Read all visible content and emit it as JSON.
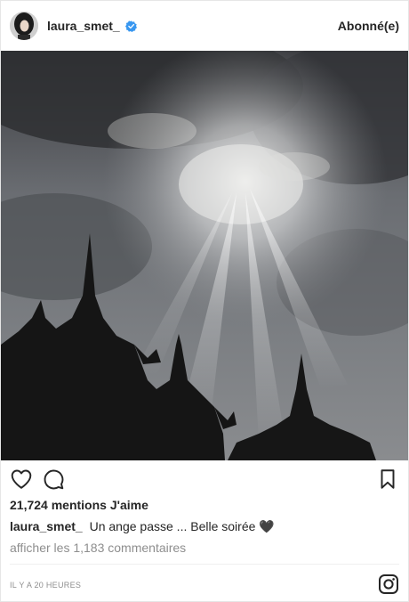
{
  "post": {
    "username": "laura_smet_",
    "follow_status": "Abonné(e)",
    "likes": "21,724 mentions J'aime",
    "caption_user": "laura_smet_",
    "caption_text": "Un ange passe ... Belle soirée 🖤",
    "view_comments": "afficher les 1,183 commentaires",
    "timestamp": "IL Y A 20 HEURES"
  },
  "icons": {
    "verified": "verified-badge-icon",
    "like": "heart-icon",
    "comment": "comment-icon",
    "save": "bookmark-icon",
    "brand": "instagram-icon"
  },
  "colors": {
    "verified": "#3897f0",
    "text": "#262626",
    "muted": "#8e8e8e"
  }
}
